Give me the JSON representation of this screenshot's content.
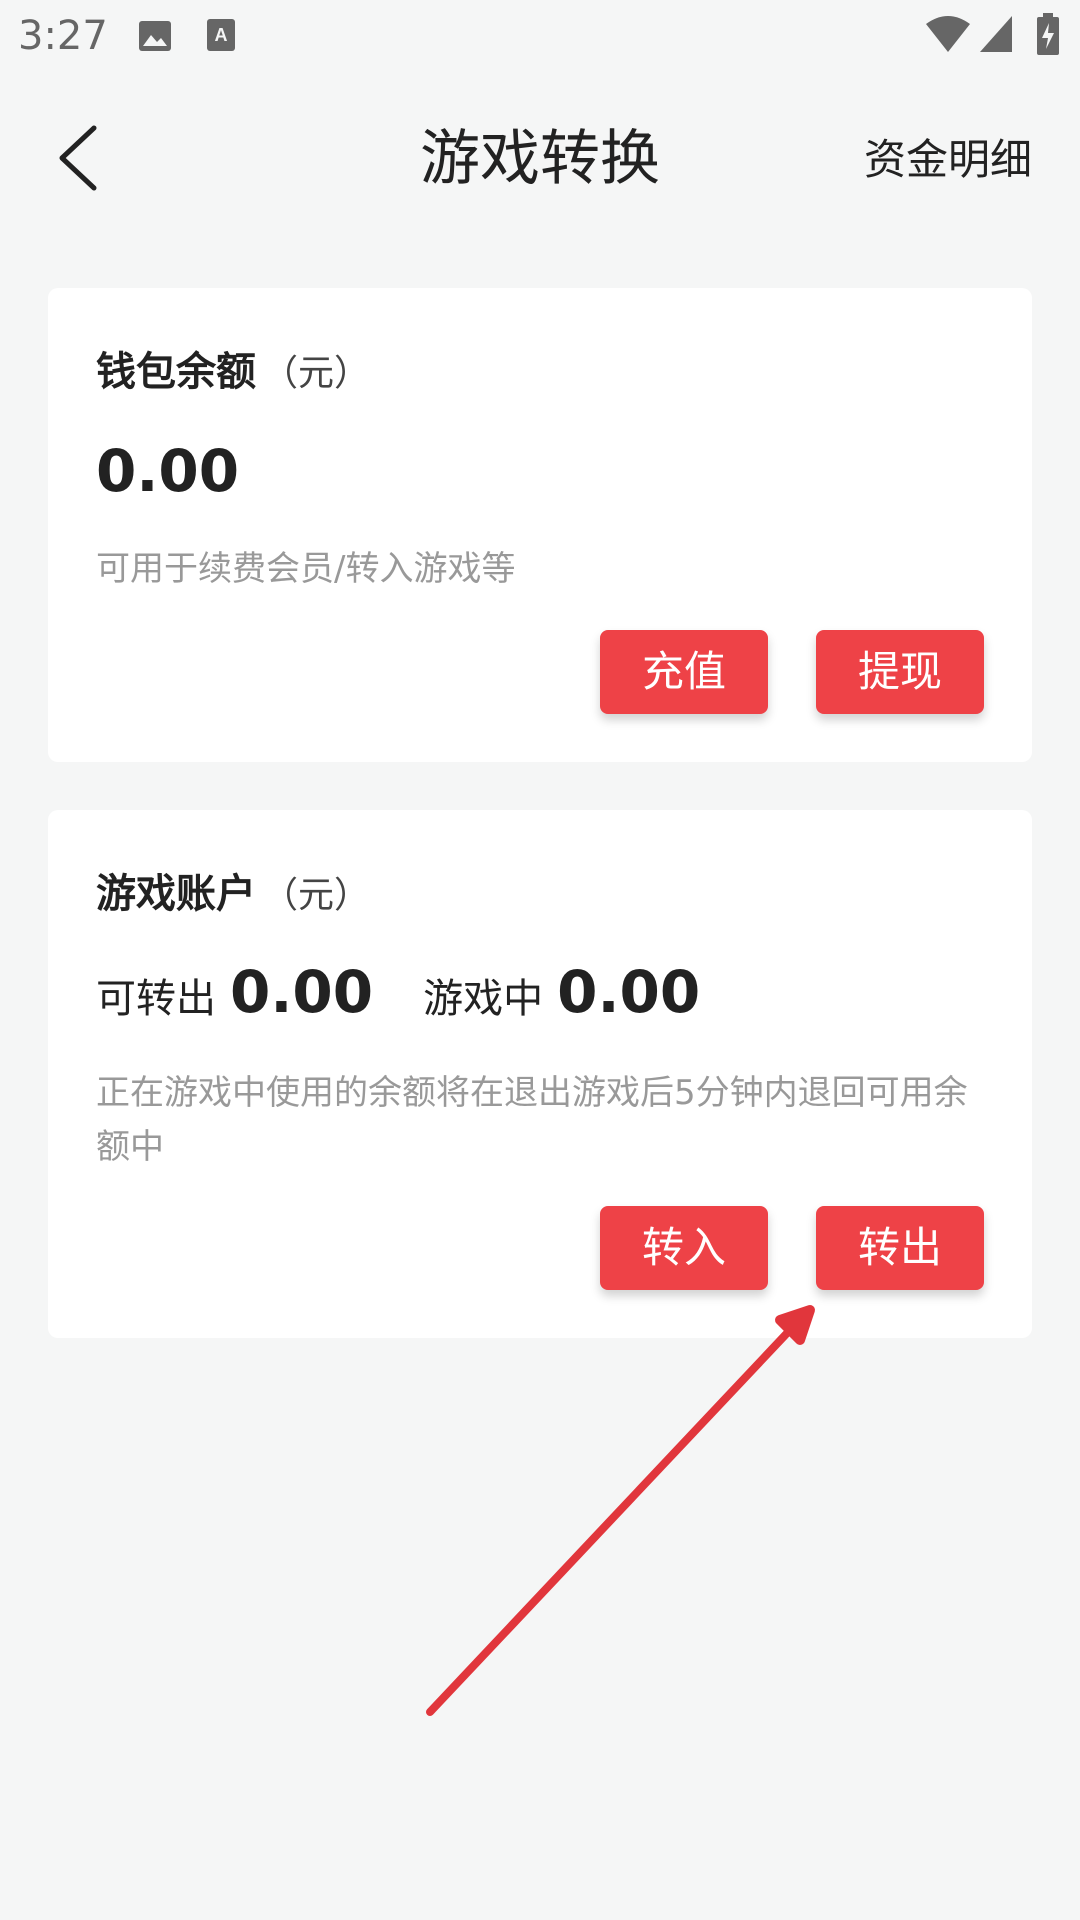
{
  "status_bar": {
    "time": "3:27",
    "icons": [
      "image-icon",
      "text-a-icon",
      "wifi-icon",
      "signal-icon",
      "battery-charging-icon"
    ]
  },
  "header": {
    "back_icon": "chevron-left-icon",
    "title": "游戏转换",
    "detail_link": "资金明细"
  },
  "wallet_card": {
    "title": "钱包余额",
    "unit": "（元）",
    "amount": "0.00",
    "hint": "可用于续费会员/转入游戏等",
    "recharge_label": "充值",
    "withdraw_label": "提现"
  },
  "game_card": {
    "title": "游戏账户",
    "unit": "（元）",
    "transferable_label": "可转出",
    "transferable_amount": "0.00",
    "in_game_label": "游戏中",
    "in_game_amount": "0.00",
    "hint": "正在游戏中使用的余额将在退出游戏后5分钟内退回可用余额中",
    "transfer_in_label": "转入",
    "transfer_out_label": "转出"
  },
  "colors": {
    "accent": "#ee4247",
    "background": "#f5f6f6",
    "card": "#ffffff",
    "hint_text": "#999999"
  }
}
